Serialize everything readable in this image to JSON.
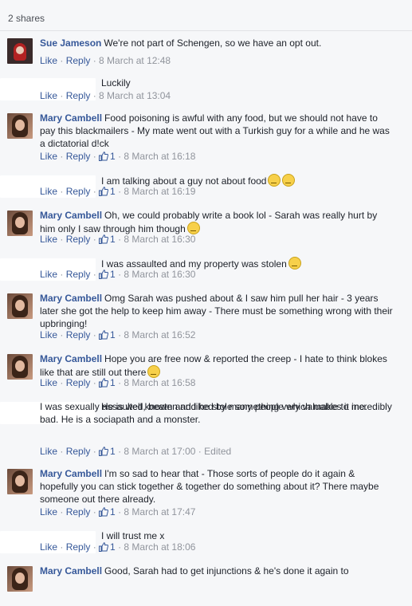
{
  "shares_label": "2 shares",
  "actions": {
    "like": "Like",
    "reply": "Reply",
    "dot": "·"
  },
  "comments": [
    {
      "author": "Sue Jameson",
      "avatar": "sue",
      "text": "We're not part of Schengen, so we have an opt out.",
      "likes": "",
      "time": "8 March at 12:48"
    },
    {
      "author": "",
      "avatar": "blank",
      "text": "Luckily",
      "likes": "",
      "time": "8 March at 13:04"
    },
    {
      "author": "Mary Cambell",
      "avatar": "mary",
      "text": "Food poisoning is awful with any food, but we should not have to pay this blackmailers - My mate went out with a Turkish guy for a while and he was a dictatorial d!ck",
      "likes": "1",
      "time": "8 March at 16:18"
    },
    {
      "author": "",
      "avatar": "blank",
      "text": "I am talking about a guy not about food",
      "emoji": [
        "sad-face-emoji",
        "laughing-face-emoji"
      ],
      "likes": "1",
      "time": "8 March at 16:19"
    },
    {
      "author": "Mary Cambell",
      "avatar": "mary",
      "text": "Oh, we could probably write a book lol - Sarah was really hurt by him only I saw through him though",
      "emoji": [
        "grimace-emoji"
      ],
      "likes": "1",
      "time": "8 March at 16:30"
    },
    {
      "author": "",
      "avatar": "blank",
      "text": "I was assaulted and my property was stolen",
      "emoji": [
        "crying-face-emoji"
      ],
      "likes": "1",
      "time": "8 March at 16:30"
    },
    {
      "author": "Mary Cambell",
      "avatar": "mary",
      "text": "Omg Sarah was pushed about & I saw him pull her hair - 3 years later she got the help to keep him away - There must be something wrong with their upbringing!",
      "likes": "1",
      "time": "8 March at 16:52"
    },
    {
      "author": "Mary Cambell",
      "avatar": "mary",
      "text": "Hope you are free now & reported the creep - I hate to think blokes like that are still out there",
      "emoji": [
        "frown-emoji"
      ],
      "likes": "1",
      "time": "8 March at 16:58"
    },
    {
      "author": "",
      "avatar": "blank",
      "text": "He is well known and liked by many people which makes it incredibly bad. He is a sociapath and a monster.",
      "text2": "I was sexually assaulted, beaten and he stole something very valuable to me.",
      "likes": "1",
      "time": "8 March at 17:00",
      "edited": "Edited"
    },
    {
      "author": "Mary Cambell",
      "avatar": "mary",
      "text": "I'm so sad to hear that - Those sorts of people do it again & hopefully you can stick together & together do something about it? There maybe someone out there already.",
      "likes": "1",
      "time": "8 March at 17:47"
    },
    {
      "author": "",
      "avatar": "blank",
      "text": "I will trust me x",
      "likes": "1",
      "time": "8 March at 18:06"
    },
    {
      "author": "Mary Cambell",
      "avatar": "mary",
      "text": "Good, Sarah had to get injunctions & he's done it again to",
      "likes": "",
      "time": ""
    }
  ]
}
